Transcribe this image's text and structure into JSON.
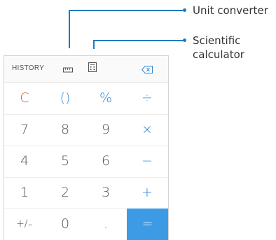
{
  "callouts": {
    "unit_converter": "Unit converter",
    "scientific": "Scientific\ncalculator"
  },
  "toolbar": {
    "history_label": "HISTORY",
    "icons": [
      "ruler-icon",
      "scientific-calculator-icon",
      "backspace-icon"
    ]
  },
  "keypad": {
    "rows": [
      [
        "C",
        "()",
        "%",
        "÷"
      ],
      [
        "7",
        "8",
        "9",
        "×"
      ],
      [
        "4",
        "5",
        "6",
        "−"
      ],
      [
        "1",
        "2",
        "3",
        "+"
      ],
      [
        "+/₋",
        "0",
        ".",
        "="
      ]
    ]
  },
  "colors": {
    "accent": "#1f7bc1",
    "operator": "#2e86d1",
    "clear": "#e2582c",
    "equals_bg": "#3d9be5"
  }
}
